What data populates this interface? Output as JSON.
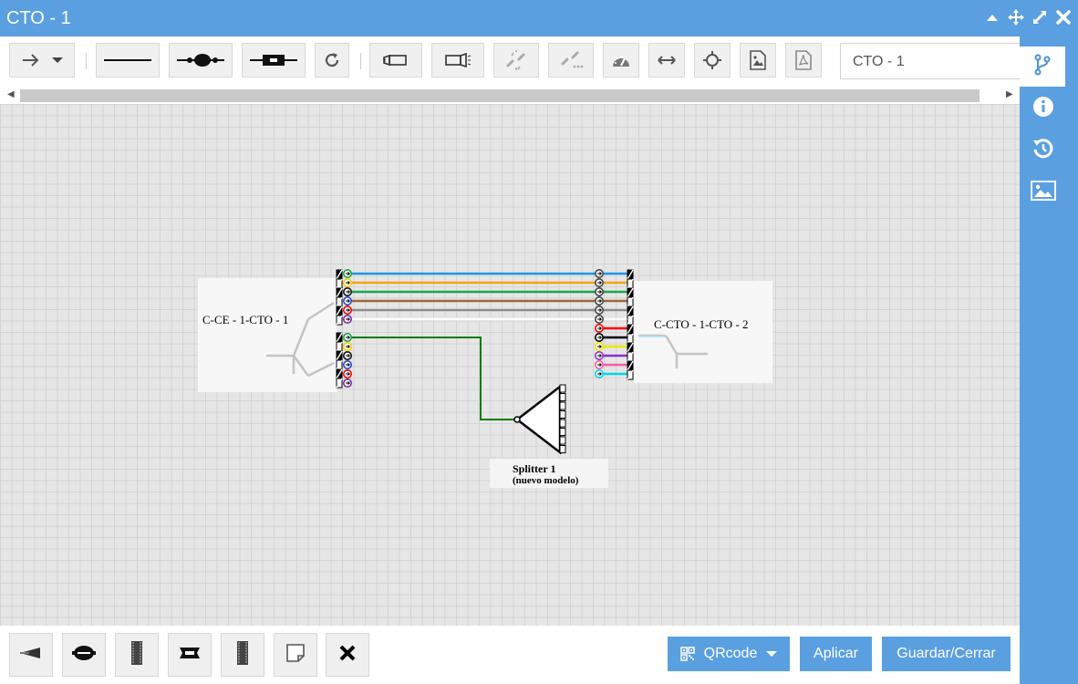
{
  "window": {
    "title": "CTO - 1"
  },
  "toolbar": {
    "name_value": "CTO - 1"
  },
  "diagram": {
    "left_box_label": "C-CE - 1-CTO - 1",
    "right_box_label": "C-CTO - 1-CTO - 2",
    "splitter_label_1": "Splitter 1",
    "splitter_label_2": "(nuevo modelo)",
    "fiber_colors": [
      "#1e9be9",
      "#f7a21b",
      "#1aa54a",
      "#a0673a",
      "#8c8c8c",
      "#ffffff",
      "#ff0000",
      "#000000",
      "#f2e600",
      "#8b2fc9",
      "#ff5aa8",
      "#00d8ea"
    ],
    "port_colors_left_top": [
      "#1aa54a",
      "#f7d000",
      "#111111",
      "#1f49d6",
      "#ff0000",
      "#7a2ba8"
    ],
    "port_colors_left_bottom": [
      "#1aa54a",
      "#f7d000",
      "#111111",
      "#1f49d6",
      "#ff0000",
      "#7a2ba8"
    ],
    "patch_color": "#0f7a0f"
  },
  "footer": {
    "qrcode_label": "QRcode",
    "apply_label": "Aplicar",
    "save_close_label": "Guardar/Cerrar"
  },
  "colors": {
    "accent": "#5a9fe0",
    "canvas": "#e6e6e6"
  }
}
